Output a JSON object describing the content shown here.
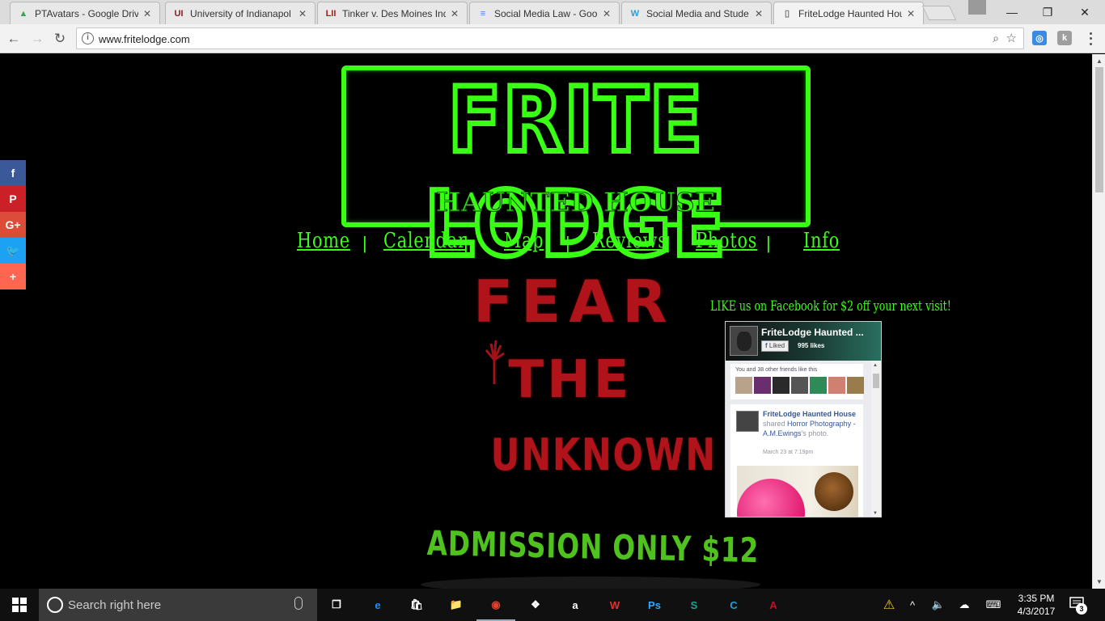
{
  "browser": {
    "tabs": [
      {
        "title": "PTAvatars - Google Driv",
        "fav": "▲",
        "fav_color": "#34a853",
        "active": false
      },
      {
        "title": "University of Indianapol",
        "fav": "UI",
        "fav_color": "#8a1c2b",
        "active": false
      },
      {
        "title": "Tinker v. Des Moines Ind",
        "fav": "LII",
        "fav_color": "#a3201e",
        "active": false
      },
      {
        "title": "Social Media Law - Goo",
        "fav": "≡",
        "fav_color": "#4285f4",
        "active": false
      },
      {
        "title": "Social Media and Stude",
        "fav": "W",
        "fav_color": "#2b9fd8",
        "active": false
      },
      {
        "title": "FriteLodge Haunted Hou",
        "fav": "▯",
        "fav_color": "#777777",
        "active": true
      }
    ],
    "tab_close": "✕",
    "window": {
      "minimize": "—",
      "maximize": "❐",
      "close": "✕"
    },
    "nav": {
      "back": "←",
      "forward": "→",
      "reload": "↻"
    },
    "url": "www.fritelodge.com",
    "info_icon": "i",
    "zoom_icon": "⌕",
    "star_icon": "☆",
    "extensions": [
      {
        "label": "◎",
        "color": "#3b8be0"
      },
      {
        "label": "k",
        "color": "#9e9e9e"
      }
    ]
  },
  "site": {
    "logo": {
      "main": "FRITE LODGE",
      "sub": "HAUNTED HOUSE"
    },
    "nav": [
      {
        "label": "Home"
      },
      {
        "label": "Calendar"
      },
      {
        "label": "Map"
      },
      {
        "label": "Reviews"
      },
      {
        "label": "Photos"
      },
      {
        "label": "Info"
      }
    ],
    "nav_separator": "|",
    "fear": {
      "line1": "FEAR",
      "line2": "THE",
      "line3": "UNKNOWN"
    },
    "admission": "ADMISSION ONLY $12",
    "fb_promo": "LIKE us on Facebook for $2 off your next visit!",
    "social": [
      {
        "label": "f",
        "color": "#3b5998",
        "name": "facebook-icon"
      },
      {
        "label": "P",
        "color": "#cb2027",
        "name": "pinterest-icon"
      },
      {
        "label": "G+",
        "color": "#dd4b39",
        "name": "google-plus-icon"
      },
      {
        "label": "🐦",
        "color": "#1da1f2",
        "name": "twitter-icon"
      },
      {
        "label": "+",
        "color": "#ff6550",
        "name": "share-plus-icon"
      }
    ]
  },
  "facebook_widget": {
    "page_name": "FriteLodge Haunted ...",
    "liked_label": "Liked",
    "likes": "995 likes",
    "friends_text": "You and 38 other friends like this",
    "friend_avatar_colors": [
      "#b8a38a",
      "#6a2d6e",
      "#2a2a2a",
      "#555555",
      "#2e8b57",
      "#d08070",
      "#9a7b4c"
    ],
    "post": {
      "author": "FriteLodge Haunted House",
      "action": "shared",
      "target": "Horror Photography - A.M.Ewings",
      "suffix": "'s photo.",
      "date": "March 23 at 7:19pm"
    }
  },
  "taskbar": {
    "search_placeholder": "Search right here",
    "apps": [
      {
        "name": "task-view-icon",
        "label": "❐",
        "color": "#ffffff"
      },
      {
        "name": "edge-icon",
        "label": "e",
        "color": "#1e90ff"
      },
      {
        "name": "store-icon",
        "label": "🛍",
        "color": "#ffffff"
      },
      {
        "name": "file-explorer-icon",
        "label": "📁",
        "color": "#f0c040"
      },
      {
        "name": "chrome-icon",
        "label": "◉",
        "color": "#e04030"
      },
      {
        "name": "dropbox-icon",
        "label": "❖",
        "color": "#ffffff"
      },
      {
        "name": "amazon-icon",
        "label": "a",
        "color": "#ffffff"
      },
      {
        "name": "wps-icon",
        "label": "W",
        "color": "#e03030"
      },
      {
        "name": "photoshop-icon",
        "label": "Ps",
        "color": "#31a8ff"
      },
      {
        "name": "sway-icon",
        "label": "S",
        "color": "#1fa38d"
      },
      {
        "name": "creative-cloud-icon",
        "label": "C",
        "color": "#1ea0dc"
      },
      {
        "name": "acrobat-icon",
        "label": "A",
        "color": "#c0102a"
      }
    ],
    "clock_time": "3:35 PM",
    "clock_date": "4/3/2017",
    "notification_count": "3"
  }
}
